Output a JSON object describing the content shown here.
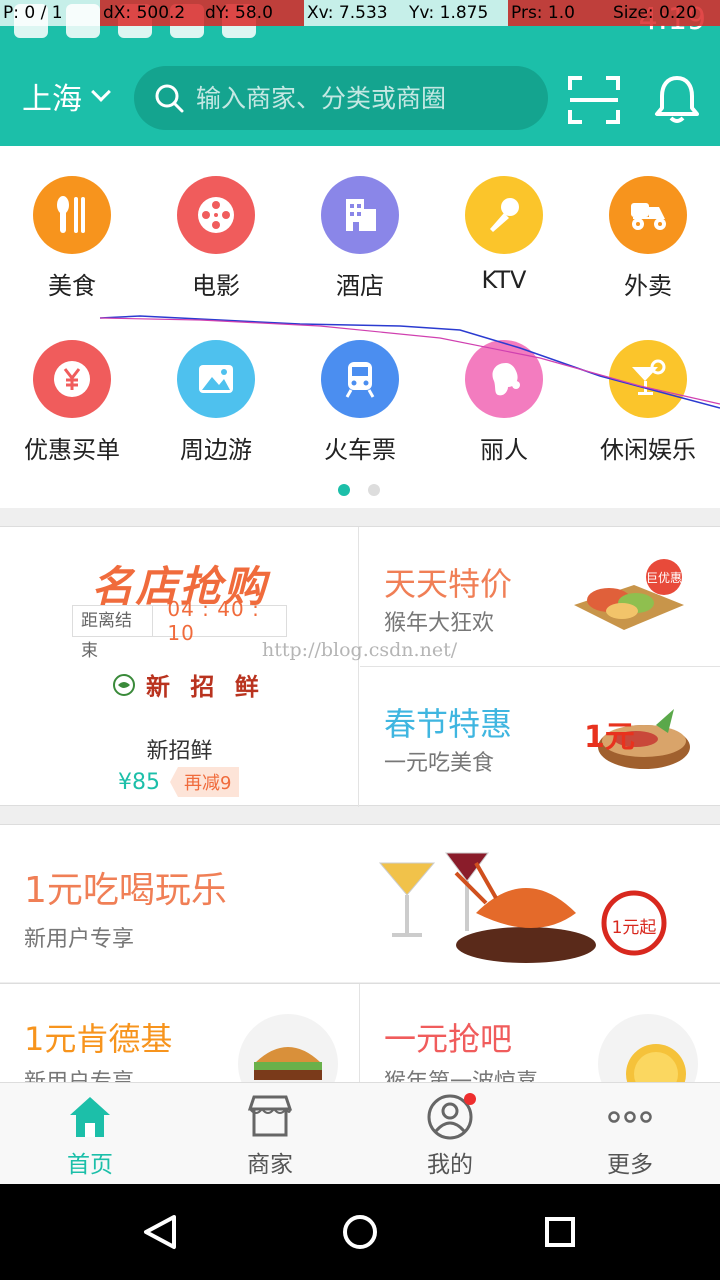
{
  "debug": {
    "pointer": "P: 0 / 1",
    "dx": "dX: 500.2",
    "dy": "dY: 58.0",
    "xv": "Xv: 7.533",
    "yv": "Yv: 1.875",
    "prs": "Prs: 1.0",
    "size": "Size: 0.20"
  },
  "status_bar": {
    "time": "4:19"
  },
  "header": {
    "city": "上海",
    "search_placeholder": "输入商家、分类或商圈"
  },
  "categories": [
    {
      "label": "美食",
      "icon": "fork-knife-icon",
      "color": "#f7941d"
    },
    {
      "label": "电影",
      "icon": "film-reel-icon",
      "color": "#f05c5c"
    },
    {
      "label": "酒店",
      "icon": "building-icon",
      "color": "#8a86e8"
    },
    {
      "label": "KTV",
      "icon": "microphone-icon",
      "color": "#fbc52b"
    },
    {
      "label": "外卖",
      "icon": "scooter-icon",
      "color": "#f7941d"
    },
    {
      "label": "优惠买单",
      "icon": "yuan-coin-icon",
      "color": "#f05c5c"
    },
    {
      "label": "周边游",
      "icon": "landscape-icon",
      "color": "#4ec1ee"
    },
    {
      "label": "火车票",
      "icon": "train-icon",
      "color": "#4b8ef0"
    },
    {
      "label": "丽人",
      "icon": "lady-icon",
      "color": "#f37cbf"
    },
    {
      "label": "休闲娱乐",
      "icon": "cocktail-icon",
      "color": "#fbc52b"
    }
  ],
  "pager": {
    "pages": 2,
    "active": 1
  },
  "flash_sale": {
    "title": "名店抢购",
    "countdown_label": "距离结束",
    "countdown": "04 : 40 : 10",
    "brand_logo_text": "新 招 鲜",
    "shop_name": "新招鲜",
    "price": "¥85",
    "discount": "再减9"
  },
  "deals": [
    {
      "title": "天天特价",
      "subtitle": "猴年大狂欢",
      "color": "#f07f56",
      "badge": "巨优惠"
    },
    {
      "title": "春节特惠",
      "subtitle": "一元吃美食",
      "color": "#3fb6e0",
      "badge": "1元"
    }
  ],
  "watermark": "http://blog.csdn.net/",
  "banner": {
    "title": "1元吃喝玩乐",
    "subtitle": "新用户专享",
    "badge": "1元起"
  },
  "promos": [
    {
      "title": "1元肯德基",
      "subtitle": "新用户专享",
      "color": "#f7941d"
    },
    {
      "title": "一元抢吧",
      "subtitle": "猴年第一波惊喜",
      "color": "#f05c5c"
    }
  ],
  "tabs": [
    {
      "label": "首页",
      "icon": "home-icon",
      "active": true
    },
    {
      "label": "商家",
      "icon": "store-icon",
      "active": false
    },
    {
      "label": "我的",
      "icon": "user-icon",
      "active": false,
      "badge": true
    },
    {
      "label": "更多",
      "icon": "more-icon",
      "active": false
    }
  ],
  "colors": {
    "primary": "#1cbfa9",
    "accent": "#f07f56"
  }
}
